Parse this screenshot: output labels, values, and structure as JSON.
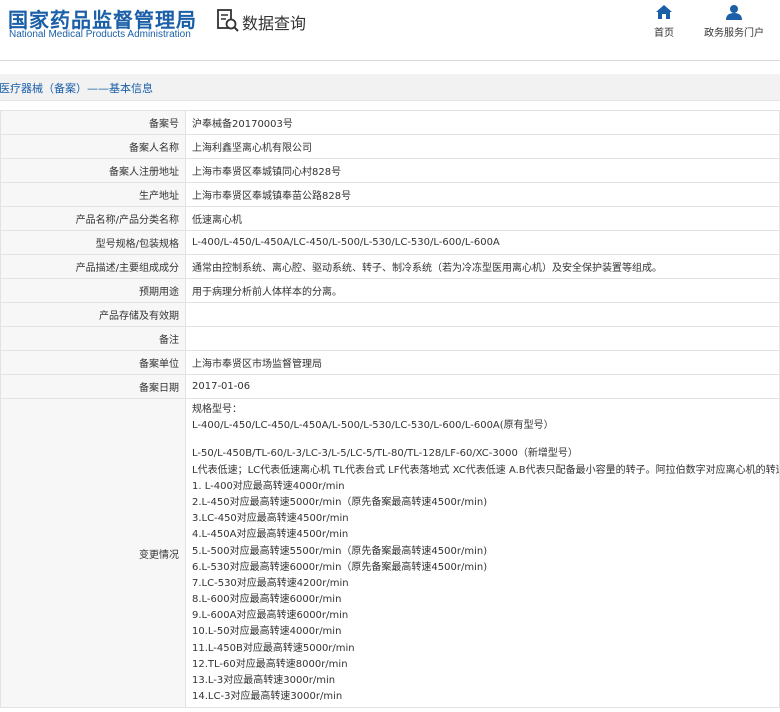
{
  "header": {
    "logo_cn": "国家药品监督管理局",
    "logo_en": "National Medical Products Administration",
    "data_query_label": "数据查询",
    "nav": [
      {
        "label": "首页",
        "icon": "home-icon"
      },
      {
        "label": "政务服务门户",
        "icon": "user-icon"
      }
    ],
    "brand_color": "#1a5fa8"
  },
  "breadcrumb": "医疗器械（备案）——基本信息",
  "fields": [
    {
      "label": "备案号",
      "value": "沪奉械备20170003号"
    },
    {
      "label": "备案人名称",
      "value": "上海利鑫坚离心机有限公司"
    },
    {
      "label": "备案人注册地址",
      "value": "上海市奉贤区奉城镇同心村828号"
    },
    {
      "label": "生产地址",
      "value": "上海市奉贤区奉城镇奉苗公路828号"
    },
    {
      "label": "产品名称/产品分类名称",
      "value": "低速离心机"
    },
    {
      "label": "型号规格/包装规格",
      "value": "L-400/L-450/L-450A/LC-450/L-500/L-530/LC-530/L-600/L-600A"
    },
    {
      "label": "产品描述/主要组成成分",
      "value": "通常由控制系统、离心腔、驱动系统、转子、制冷系统（若为冷冻型医用离心机）及安全保护装置等组成。"
    },
    {
      "label": "预期用途",
      "value": "用于病理分析前人体样本的分离。"
    },
    {
      "label": "产品存储及有效期",
      "value": ""
    },
    {
      "label": "备注",
      "value": ""
    },
    {
      "label": "备案单位",
      "value": "上海市奉贤区市场监督管理局"
    },
    {
      "label": "备案日期",
      "value": "2017-01-06"
    }
  ],
  "change": {
    "label": "变更情况",
    "lines": [
      "规格型号：",
      "L-400/L-450/LC-450/L-450A/L-500/L-530/LC-530/L-600/L-600A(原有型号）",
      "",
      "L-50/L-450B/TL-60/L-3/LC-3/L-5/LC-5/TL-80/TL-128/LF-60/XC-3000（新增型号）",
      "L代表低速；LC代表低速离心机 TL代表台式 LF代表落地式 XC代表低速 A.B代表只配备最小容量的转子。阿拉伯数字对应离心机的转速",
      "1. L-400对应最高转速4000r/min",
      "2.L-450对应最高转速5000r/min（原先备案最高转速4500r/min)",
      "3.LC-450对应最高转速4500r/min",
      "4.L-450A对应最高转速4500r/min",
      "5.L-500对应最高转速5500r/min（原先备案最高转速4500r/min)",
      "6.L-530对应最高转速6000r/min（原先备案最高转速4500r/min)",
      "7.LC-530对应最高转速4200r/min",
      "8.L-600对应最高转速6000r/min",
      "9.L-600A对应最高转速6000r/min",
      "10.L-50对应最高转速4000r/min",
      "11.L-450B对应最高转速5000r/min",
      "12.TL-60对应最高转速8000r/min",
      "13.L-3对应最高转速3000r/min",
      "14.LC-3对应最高转速3000r/min"
    ]
  }
}
